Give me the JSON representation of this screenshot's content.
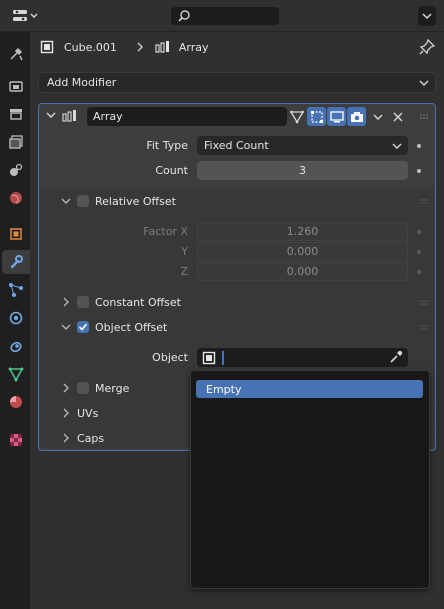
{
  "header": {
    "editor_type_icon": "properties-editor-icon",
    "search": {
      "placeholder": "",
      "icon": "search-icon"
    }
  },
  "breadcrumb": {
    "object": "Cube.001",
    "modifier": "Array",
    "pin_icon": "pin-icon"
  },
  "add_modifier_label": "Add Modifier",
  "tabs": [
    "tool",
    "render",
    "output",
    "view-layer",
    "scene",
    "world",
    "object",
    "modifiers",
    "particles",
    "physics",
    "constraints",
    "object-data",
    "material",
    "texture"
  ],
  "active_tab": "modifiers",
  "modifier": {
    "name": "Array",
    "fit_type": {
      "label": "Fit Type",
      "value": "Fixed Count"
    },
    "count": {
      "label": "Count",
      "value": "3"
    },
    "relative_offset": {
      "label": "Relative Offset",
      "checked": false,
      "factor_x": {
        "label": "Factor X",
        "value": "1.260"
      },
      "y": {
        "label": "Y",
        "value": "0.000"
      },
      "z": {
        "label": "Z",
        "value": "0.000"
      }
    },
    "constant_offset": {
      "label": "Constant Offset",
      "checked": false
    },
    "object_offset": {
      "label": "Object Offset",
      "checked": true,
      "object_label": "Object"
    },
    "merge": {
      "label": "Merge",
      "checked": false
    },
    "uvs": {
      "label": "UVs"
    },
    "caps": {
      "label": "Caps"
    }
  },
  "dropdown": {
    "items": [
      "Empty"
    ]
  },
  "colors": {
    "accent": "#4772b3",
    "panel": "#303030",
    "box": "#3d3d3d"
  }
}
